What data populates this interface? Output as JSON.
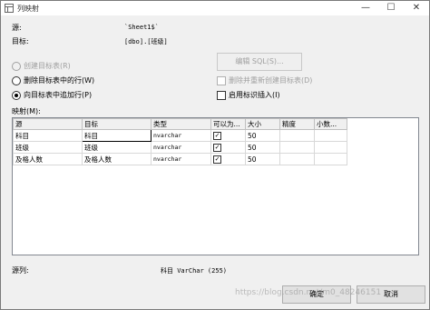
{
  "window": {
    "title": "列映射",
    "minimize": "—",
    "maximize": "☐",
    "close": "✕"
  },
  "source": {
    "label": "源:",
    "value": "`Sheet1$`"
  },
  "target": {
    "label": "目标:",
    "value": "[dbo].[班级]"
  },
  "options": {
    "create_target": "创建目标表(R)",
    "delete_rows": "删除目标表中的行(W)",
    "append_rows": "向目标表中追加行(P)",
    "edit_sql": "编辑 SQL(S)...",
    "drop_recreate": "删除并重新创建目标表(D)",
    "identity_insert": "启用标识插入(I)"
  },
  "mappings_label": "映射(M):",
  "table": {
    "columns": [
      "源",
      "目标",
      "类型",
      "可以为...",
      "大小",
      "精度",
      "小数..."
    ],
    "rows": [
      {
        "source": "科目",
        "target": "科目",
        "type": "nvarchar",
        "nullable": true,
        "size": "50",
        "precision": "",
        "scale": ""
      },
      {
        "source": "班级",
        "target": "班级",
        "type": "nvarchar",
        "nullable": true,
        "size": "50",
        "precision": "",
        "scale": ""
      },
      {
        "source": "及格人数",
        "target": "及格人数",
        "type": "nvarchar",
        "nullable": true,
        "size": "50",
        "precision": "",
        "scale": ""
      }
    ]
  },
  "source_column": {
    "label": "源列:",
    "value": "科目 VarChar (255)"
  },
  "buttons": {
    "ok": "确定",
    "cancel": "取消"
  },
  "watermark": "https://blog.csdn.net/m0_48246151"
}
